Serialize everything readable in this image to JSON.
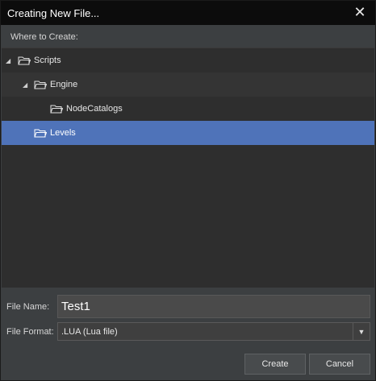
{
  "window": {
    "title": "Creating New File...",
    "close_icon": "close-icon"
  },
  "where_label": "Where to Create:",
  "tree": {
    "items": [
      {
        "label": "Scripts",
        "depth": 0,
        "expanded": true,
        "icon": "folder-open-icon"
      },
      {
        "label": "Engine",
        "depth": 1,
        "expanded": true,
        "icon": "folder-open-icon"
      },
      {
        "label": "NodeCatalogs",
        "depth": 2,
        "expanded": false,
        "icon": "folder-open-icon"
      },
      {
        "label": "Levels",
        "depth": 1,
        "expanded": false,
        "selected": true,
        "icon": "folder-open-icon"
      }
    ]
  },
  "form": {
    "file_name_label": "File Name:",
    "file_name_value": "Test1",
    "file_format_label": "File Format:",
    "file_format_value": ".LUA (Lua file)"
  },
  "buttons": {
    "create": "Create",
    "cancel": "Cancel"
  },
  "colors": {
    "selection": "#4f73b9",
    "title_bar": "#0c0c0c",
    "panel": "#3c3f41"
  }
}
